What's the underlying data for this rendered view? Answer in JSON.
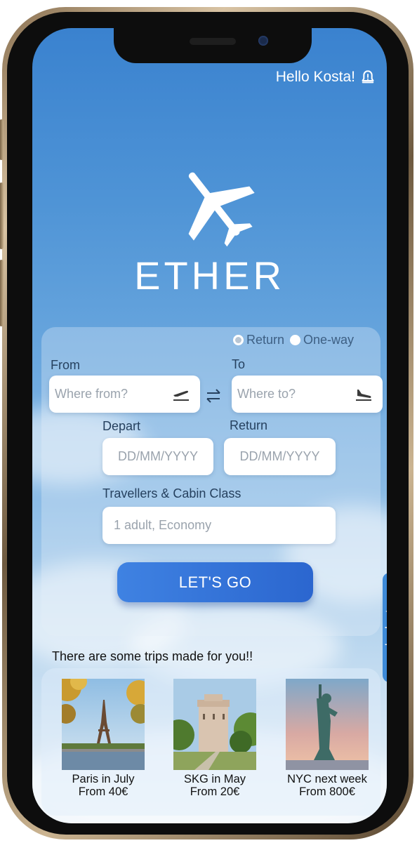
{
  "header": {
    "greeting": "Hello Kosta!",
    "icon": "bell-alert-icon"
  },
  "brand": {
    "name": "ETHER",
    "icon": "airplane-icon"
  },
  "trip_type": {
    "options": [
      "Return",
      "One-way"
    ],
    "selected": "Return"
  },
  "search": {
    "from_label": "From",
    "from_placeholder": "Where from?",
    "to_label": "To",
    "to_placeholder": "Where to?",
    "depart_label": "Depart",
    "depart_placeholder": "DD/MM/YYYY",
    "return_label": "Return",
    "return_placeholder": "DD/MM/YYYY",
    "travellers_label": "Travellers & Cabin Class",
    "travellers_value": "1 adult, Economy",
    "submit_label": "LET'S GO"
  },
  "budget_tab": {
    "label": "budget"
  },
  "trips": {
    "title": "There are some trips made for you!!",
    "items": [
      {
        "name": "Paris in July",
        "price": "From 40€"
      },
      {
        "name": "SKG in May",
        "price": "From 20€"
      },
      {
        "name": "NYC next week",
        "price": "From 800€"
      }
    ]
  },
  "colors": {
    "accent": "#2f6fd6",
    "sky": "#4f94d6",
    "text_dark": "#26415f"
  }
}
